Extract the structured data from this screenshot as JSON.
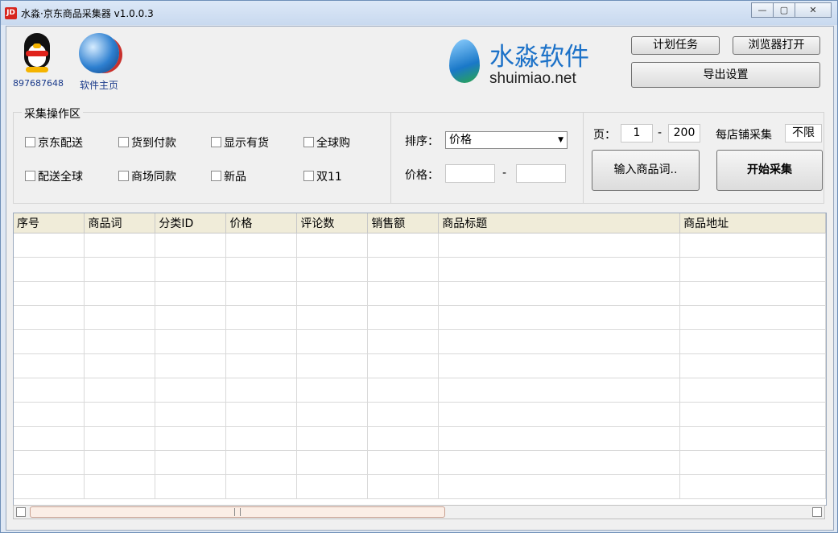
{
  "window": {
    "app_icon": "JD",
    "title": "水淼·京东商品采集器 v1.0.0.3",
    "min_label": "—",
    "max_label": "▢",
    "close_label": "✕"
  },
  "header": {
    "qq_number": "897687648",
    "home_link": "软件主页",
    "brand_cn": "水淼软件",
    "brand_en": "shuimiao.net",
    "schedule_button": "计划任务",
    "browser_button": "浏览器打开",
    "export_button": "导出设置"
  },
  "filters": {
    "group_title": "采集操作区",
    "checkboxes": [
      {
        "label": "京东配送",
        "checked": false
      },
      {
        "label": "货到付款",
        "checked": false
      },
      {
        "label": "显示有货",
        "checked": false
      },
      {
        "label": "全球购",
        "checked": false
      },
      {
        "label": "配送全球",
        "checked": false
      },
      {
        "label": "商场同款",
        "checked": false
      },
      {
        "label": "新品",
        "checked": false
      },
      {
        "label": "双11",
        "checked": false
      }
    ],
    "sort_label": "排序：",
    "sort_value": "价格",
    "price_label": "价格：",
    "price_min": "",
    "price_max": "",
    "range_dash": "-"
  },
  "paging": {
    "page_label": "页：",
    "page_from": "1",
    "page_dash": "-",
    "page_to": "200",
    "per_store_label": "每店铺采集",
    "per_store_value": "不限",
    "keywords_button": "输入商品词..",
    "start_button": "开始采集"
  },
  "table": {
    "columns": [
      "序号",
      "商品词",
      "分类ID",
      "价格",
      "评论数",
      "销售额",
      "商品标题",
      "商品地址"
    ],
    "rows": []
  }
}
